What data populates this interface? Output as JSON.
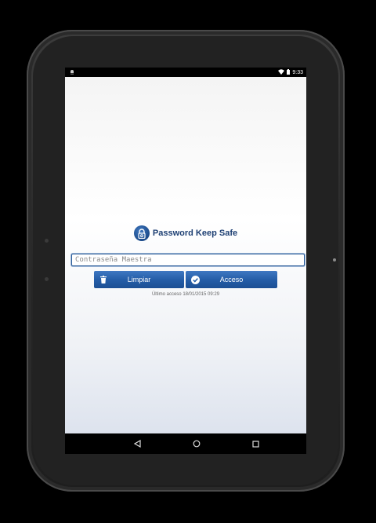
{
  "status_bar": {
    "time": "9:33",
    "icons": [
      "android-notification-icon",
      "wifi-icon",
      "battery-icon"
    ]
  },
  "app": {
    "title": "Password Keep Safe",
    "logo_icon": "padlock-icon",
    "password_field": {
      "placeholder": "Contraseña Maestra",
      "value": ""
    },
    "buttons": {
      "clear_label": "Limpiar",
      "clear_icon": "trash-icon",
      "login_label": "Acceso",
      "login_icon": "checkmark-icon"
    },
    "last_access": "Último acceso 18/01/2015 09:29"
  },
  "nav_bar": {
    "icons": [
      "back-icon",
      "home-icon",
      "recents-icon"
    ]
  },
  "colors": {
    "accent": "#255ea8",
    "title": "#1d3f73",
    "background": "#ffffff"
  }
}
